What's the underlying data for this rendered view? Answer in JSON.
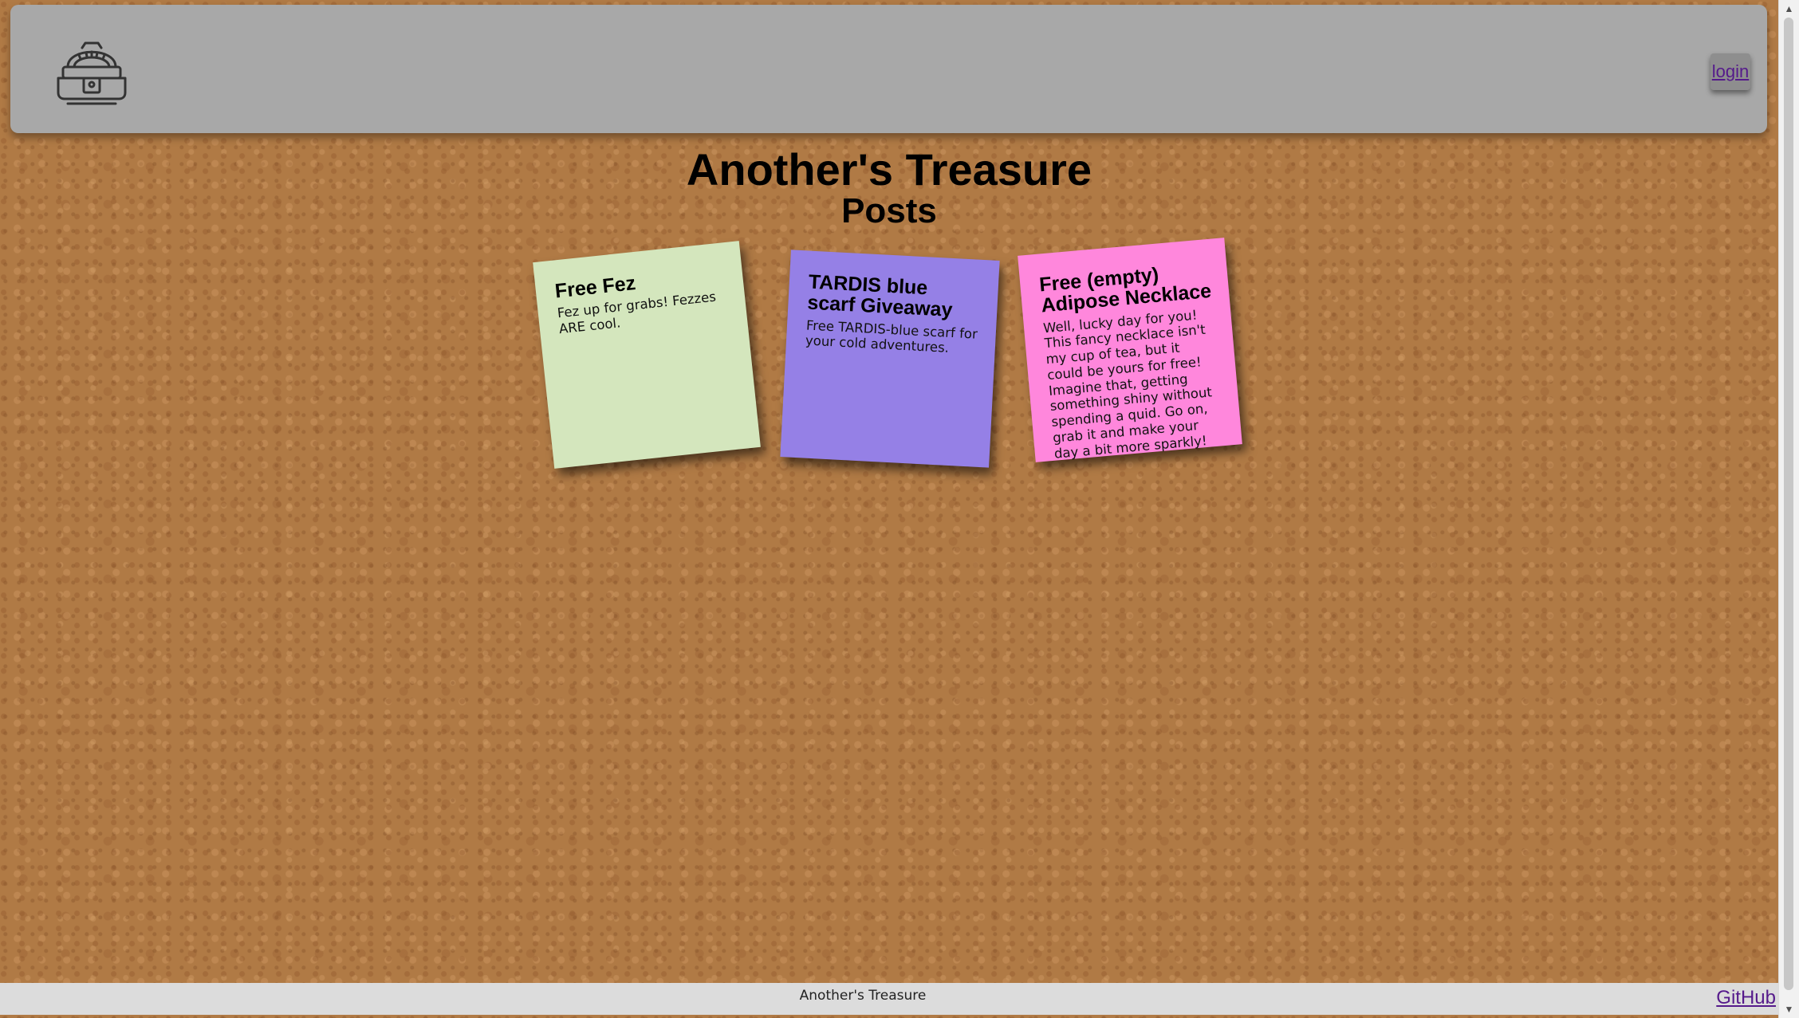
{
  "header": {
    "logo_icon": "treasure-chest-icon",
    "login_label": "login"
  },
  "main": {
    "title": "Another's Treasure",
    "subtitle": "Posts",
    "posts": [
      {
        "title": "Free Fez",
        "body": "Fez up for grabs! Fezzes ARE cool.",
        "color": "#d4e6bd"
      },
      {
        "title": "TARDIS blue scarf Giveaway",
        "body": "Free TARDIS-blue scarf for your cold adventures.",
        "color": "#9580e6"
      },
      {
        "title": "Free (empty) Adipose Necklace",
        "body": "Well, lucky day for you! This fancy necklace isn't my cup of tea, but it could be yours for free! Imagine that, getting something shiny without spending a quid. Go on, grab it and make your day a bit more sparkly!",
        "color": "#ff87dc"
      }
    ]
  },
  "footer": {
    "title": "Another's Treasure",
    "link_label": "GitHub"
  }
}
